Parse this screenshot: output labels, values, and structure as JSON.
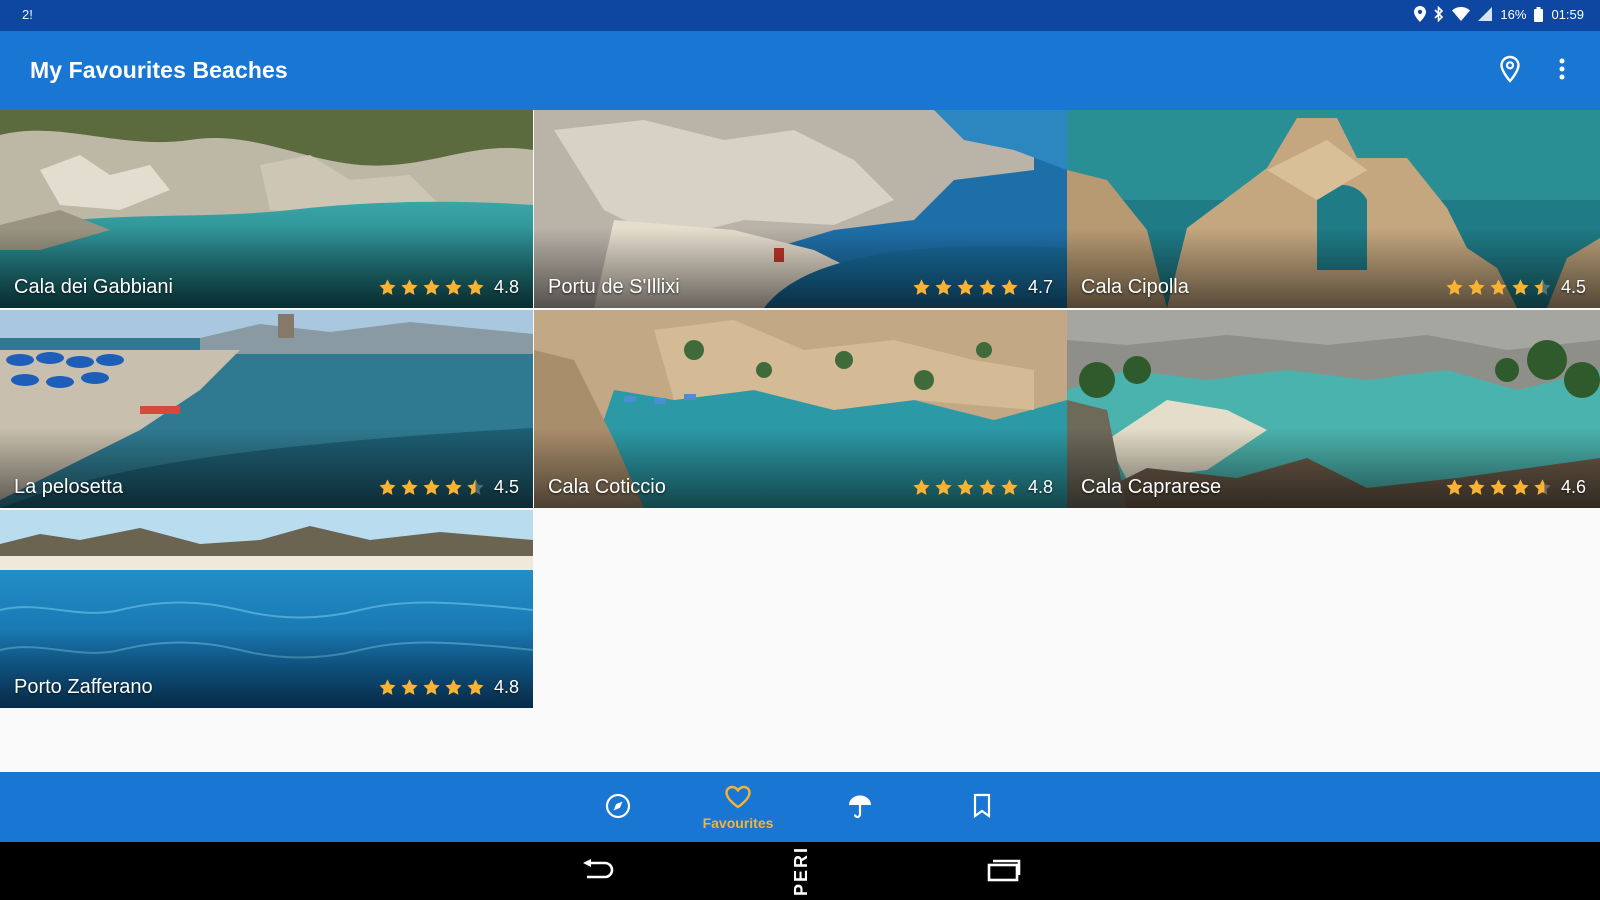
{
  "status_bar": {
    "left_text": "2!",
    "battery": "16%",
    "time": "01:59"
  },
  "app_bar": {
    "title": "My Favourites Beaches",
    "actions": [
      "location-pin-icon",
      "more-vert-icon"
    ]
  },
  "beaches": [
    {
      "name": "Cala dei Gabbiani",
      "rating": 4.8,
      "rating_label": "4.8"
    },
    {
      "name": "Portu de S'Illixi",
      "rating": 4.7,
      "rating_label": "4.7"
    },
    {
      "name": "Cala Cipolla",
      "rating": 4.5,
      "rating_label": "4.5"
    },
    {
      "name": "La pelosetta",
      "rating": 4.5,
      "rating_label": "4.5"
    },
    {
      "name": "Cala Coticcio",
      "rating": 4.8,
      "rating_label": "4.8"
    },
    {
      "name": "Cala Caprarese",
      "rating": 4.6,
      "rating_label": "4.6"
    },
    {
      "name": "Porto Zafferano",
      "rating": 4.8,
      "rating_label": "4.8"
    }
  ],
  "bottom_nav": {
    "items": [
      {
        "icon": "compass-icon",
        "label": ""
      },
      {
        "icon": "heart-icon",
        "label": "Favourites"
      },
      {
        "icon": "umbrella-icon",
        "label": ""
      },
      {
        "icon": "bookmark-icon",
        "label": ""
      }
    ],
    "active_color": "#f9b233"
  },
  "system_nav": {
    "center_text": "PERI"
  },
  "colors": {
    "primary": "#1976d2",
    "primary_dark": "#0d47a1",
    "star": "#f9b233"
  }
}
